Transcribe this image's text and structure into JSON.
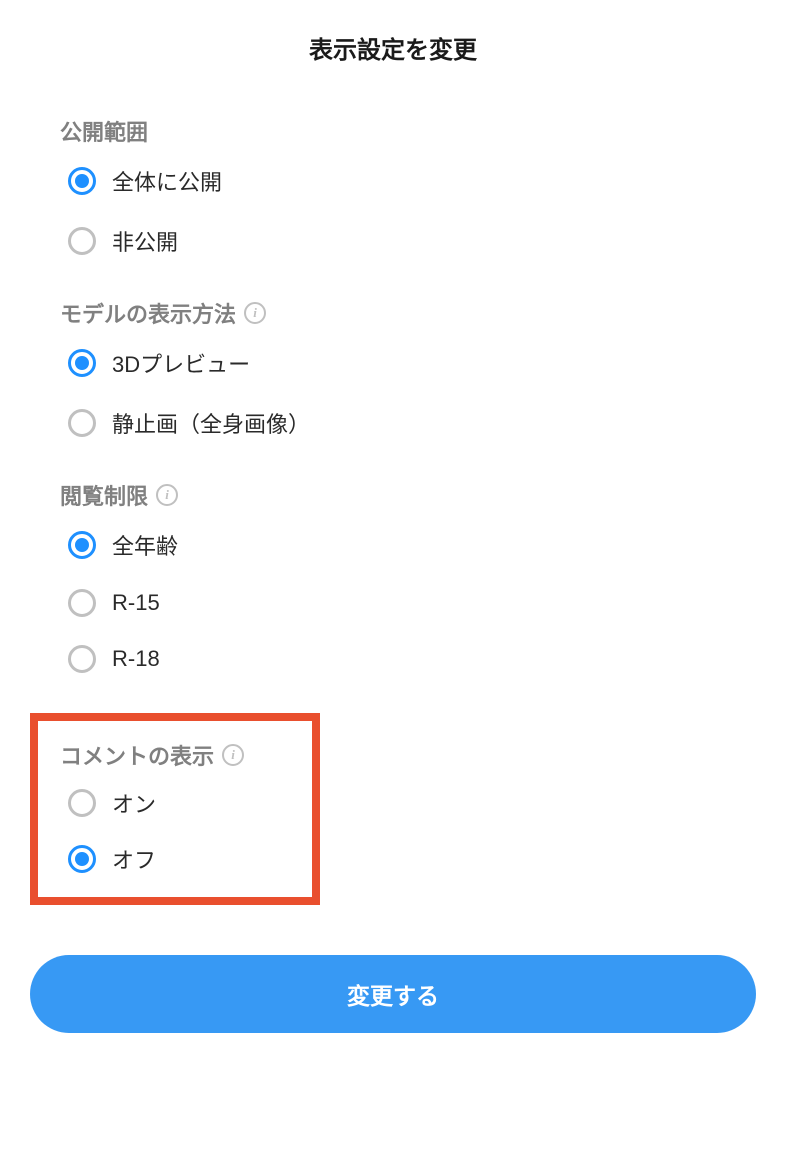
{
  "dialog": {
    "title": "表示設定を変更"
  },
  "sections": {
    "visibility": {
      "title": "公開範囲",
      "options": {
        "public": "全体に公開",
        "private": "非公開"
      }
    },
    "display_method": {
      "title": "モデルの表示方法",
      "options": {
        "preview_3d": "3Dプレビュー",
        "still_image": "静止画（全身画像）"
      }
    },
    "age_restriction": {
      "title": "閲覧制限",
      "options": {
        "all_ages": "全年齢",
        "r15": "R-15",
        "r18": "R-18"
      }
    },
    "comments": {
      "title": "コメントの表示",
      "options": {
        "on": "オン",
        "off": "オフ"
      }
    }
  },
  "submit": {
    "label": "変更する"
  }
}
